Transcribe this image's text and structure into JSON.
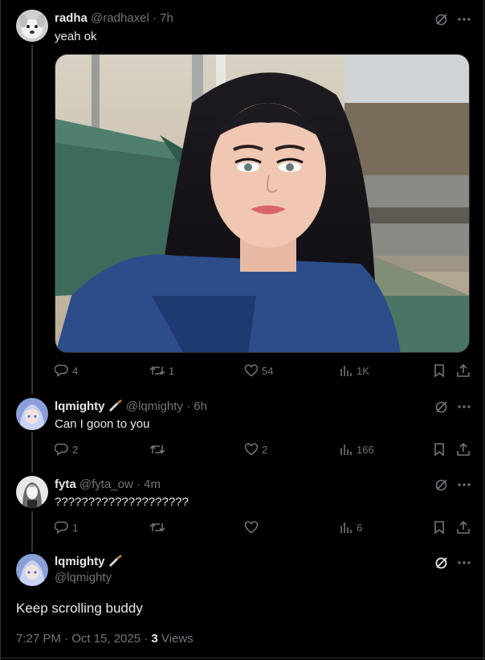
{
  "posts": [
    {
      "name": "radha",
      "handle": "@radhaxel",
      "time": "· 7h",
      "text": "yeah ok",
      "stats": {
        "replies": "4",
        "reposts": "1",
        "likes": "54",
        "views": "1K"
      }
    },
    {
      "name": "lqmighty",
      "badge_icon": "knife-emoji",
      "handle": "@lqmighty",
      "time": "· 6h",
      "text": "Can I goon to you",
      "stats": {
        "replies": "2",
        "reposts": "",
        "likes": "2",
        "views": "166"
      }
    },
    {
      "name": "fyta",
      "handle": "@fyta_ow",
      "time": "· 4m",
      "text": "????????????????????",
      "stats": {
        "replies": "1",
        "reposts": "",
        "likes": "",
        "views": "6"
      }
    }
  ],
  "main_post": {
    "name": "lqmighty",
    "badge_icon": "knife-emoji",
    "handle": "@lqmighty",
    "text": "Keep scrolling buddy",
    "timestamp": "7:27 PM · Oct 15, 2025 · ",
    "views_count": "3",
    "views_label": " Views"
  },
  "colors": {
    "background": "#000000",
    "text": "#e7e9ea",
    "muted": "#71767b",
    "divider": "#2f3336"
  }
}
